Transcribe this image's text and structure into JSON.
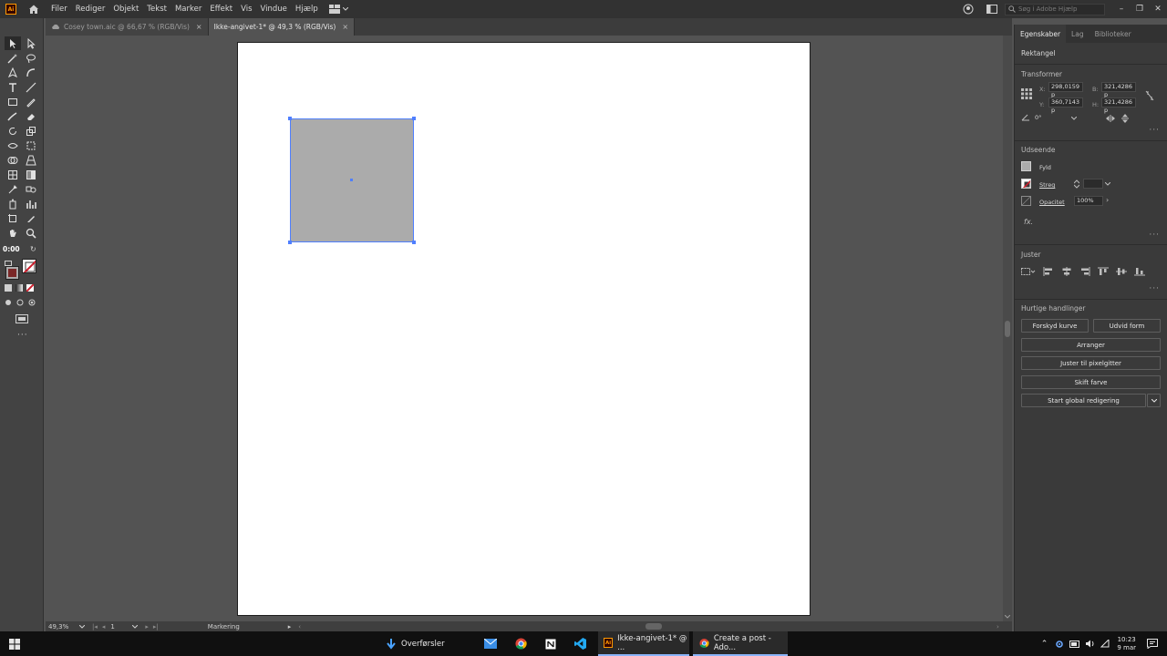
{
  "app": {
    "logo_text": "Ai",
    "menu": [
      "Filer",
      "Rediger",
      "Objekt",
      "Tekst",
      "Marker",
      "Effekt",
      "Vis",
      "Vindue",
      "Hjælp"
    ],
    "search_placeholder": "Søg i Adobe Hjælp"
  },
  "tabs": [
    {
      "label": "Cosey town.aic @ 66,67 % (RGB/Vis)",
      "close": "×"
    },
    {
      "label": "Ikke-angivet-1* @ 49,3 % (RGB/Vis)",
      "close": "×"
    }
  ],
  "toolbar": {
    "timer": "0:00"
  },
  "statusbar": {
    "zoom": "49,3%",
    "artboard_num": "1",
    "tool_name": "Markering"
  },
  "panel": {
    "tabs": [
      "Egenskaber",
      "Lag",
      "Biblioteker"
    ],
    "object_type": "Rektangel",
    "transform": {
      "title": "Transformer",
      "x_label": "X:",
      "x": "298,0159 p",
      "y_label": "Y:",
      "y": "360,7143 p",
      "w_label": "B:",
      "w": "321,4286 p",
      "h_label": "H:",
      "h": "321,4286 p",
      "angle": "0°"
    },
    "appearance": {
      "title": "Udseende",
      "fill": "Fyld",
      "stroke": "Streg",
      "opacity_label": "Opacitet",
      "opacity": "100%",
      "fx": "fx."
    },
    "align": {
      "title": "Juster"
    },
    "quick_actions": {
      "title": "Hurtige handlinger",
      "offset_path": "Forskyd kurve",
      "expand_shape": "Udvid form",
      "arrange": "Arranger",
      "align_pixel": "Juster til pixelgitter",
      "recolor": "Skift farve",
      "global_edit": "Start global redigering"
    }
  },
  "taskbar": {
    "downloads": "Overførsler",
    "ai_window": "Ikke-angivet-1* @ ...",
    "chrome_window": "Create a post - Ado...",
    "time": "10:23",
    "date": "9 mar"
  },
  "colors": {
    "selection": "#4f7fff",
    "shape_fill": "#ababab",
    "stroke_swatch": "#cc1f2d"
  }
}
